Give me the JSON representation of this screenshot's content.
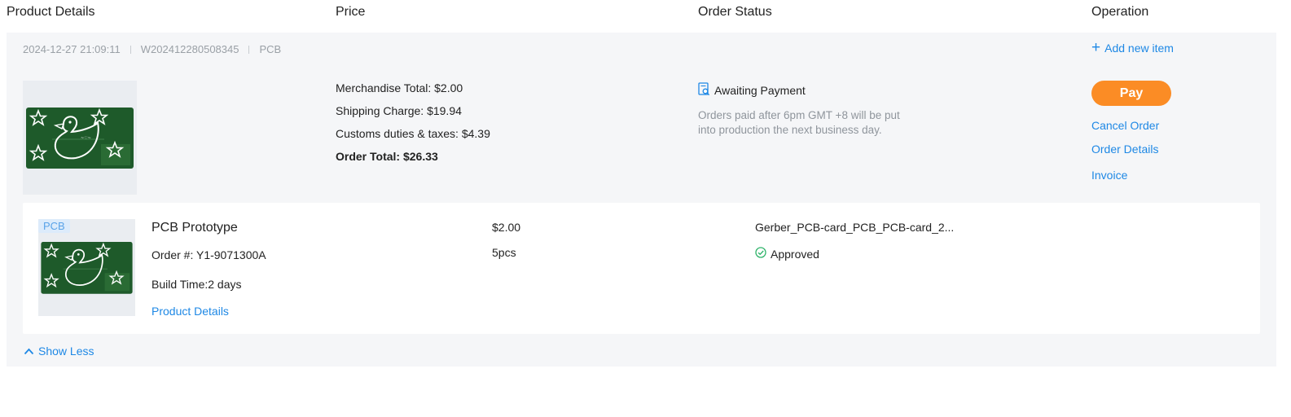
{
  "columns": {
    "product_details": "Product Details",
    "price": "Price",
    "order_status": "Order Status",
    "operation": "Operation"
  },
  "order": {
    "datetime": "2024-12-27 21:09:11",
    "order_no": "W202412280508345",
    "category": "PCB",
    "add_item_label": "Add new item",
    "price": {
      "merchandise": "Merchandise Total: $2.00",
      "shipping": "Shipping Charge: $19.94",
      "customs": "Customs duties & taxes: $4.39",
      "total": "Order Total: $26.33"
    },
    "status": {
      "label": "Awaiting Payment",
      "note": "Orders paid after 6pm GMT +8 will be put into production the next business day."
    },
    "operations": {
      "pay": "Pay",
      "cancel": "Cancel Order",
      "details": "Order Details",
      "invoice": "Invoice"
    },
    "item": {
      "badge": "PCB",
      "title": "PCB Prototype",
      "order_number": "Order #: Y1-9071300A",
      "build_time": "Build Time:2 days",
      "details_link": "Product Details",
      "price": "$2.00",
      "quantity": "5pcs",
      "file": "Gerber_PCB-card_PCB_PCB-card_2...",
      "review_status": "Approved"
    },
    "show_less_label": "Show Less"
  },
  "colors": {
    "accent": "#1e88e5",
    "pay": "#fb8c25",
    "pcb_green": "#1e5a2a",
    "approved_green": "#2fb36a",
    "muted": "#9aa0a6"
  }
}
